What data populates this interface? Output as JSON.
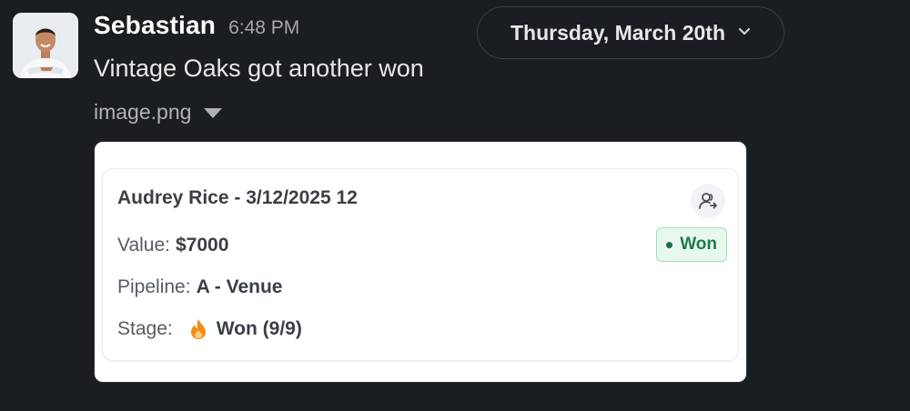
{
  "message": {
    "sender": "Sebastian",
    "time": "6:48 PM",
    "text": "Vintage Oaks got another won",
    "attachment_name": "image.png"
  },
  "date_divider": {
    "label": "Thursday, March 20th",
    "icon": "chevron-down-icon"
  },
  "deal_card": {
    "title": "Audrey Rice - 3/12/2025 12",
    "value_label": "Value:",
    "value": "$7000",
    "pipeline_label": "Pipeline:",
    "pipeline": "A - Venue",
    "stage_label": "Stage:",
    "stage": "Won (9/9)",
    "status_badge": "Won",
    "icons": [
      "user-assign-icon",
      "flame-icon"
    ]
  },
  "colors": {
    "background": "#1a1d21",
    "won_green": "#1f7a4a",
    "won_bg": "#e7f8ee",
    "flame": "#f28c1a"
  }
}
